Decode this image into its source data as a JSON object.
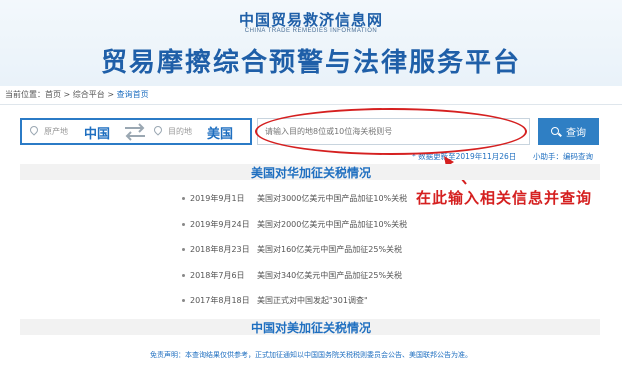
{
  "header": {
    "site_name": "中国贸易救济信息网",
    "site_name_en": "CHINA TRADE REMEDIES INFORMATION",
    "platform_title": "贸易摩擦综合预警与法律服务平台"
  },
  "breadcrumb": {
    "prefix": "当前位置：",
    "items": [
      "首页",
      "综合平台",
      "查询首页"
    ],
    "separator": " > "
  },
  "search": {
    "origin_label": "原产地",
    "origin_value": "中国",
    "destination_label": "目的地",
    "destination_value": "美国",
    "code_placeholder": "请输入目的地8位或10位海关税则号",
    "query_button": "查询",
    "update_note": "* 数据更新至2019年11月26日",
    "helper_link": "小助手：编码查询"
  },
  "annotation": {
    "text": "在此输入相关信息并查询",
    "color": "#d52020"
  },
  "us_tariffs": {
    "title": "美国对华加征关税情况",
    "items": [
      {
        "date": "2019年9月1日",
        "desc": "美国对3000亿美元中国产品加征10%关税"
      },
      {
        "date": "2019年9月24日",
        "desc": "美国对2000亿美元中国产品加征10%关税"
      },
      {
        "date": "2018年8月23日",
        "desc": "美国对160亿美元中国产品加征25%关税"
      },
      {
        "date": "2018年7月6日",
        "desc": "美国对340亿美元中国产品加征25%关税"
      },
      {
        "date": "2017年8月18日",
        "desc": "美国正式对中国发起\"301调查\""
      }
    ]
  },
  "china_tariffs": {
    "title": "中国对美加征关税情况"
  },
  "disclaimer": "免责声明：本查询结果仅供参考，正式加征通知以中国国务院关税税则委员会公告、美国联邦公告为准。",
  "colors": {
    "brand_blue": "#1f6fc0",
    "button_blue": "#2f7fc4",
    "annotation_red": "#d52020"
  }
}
